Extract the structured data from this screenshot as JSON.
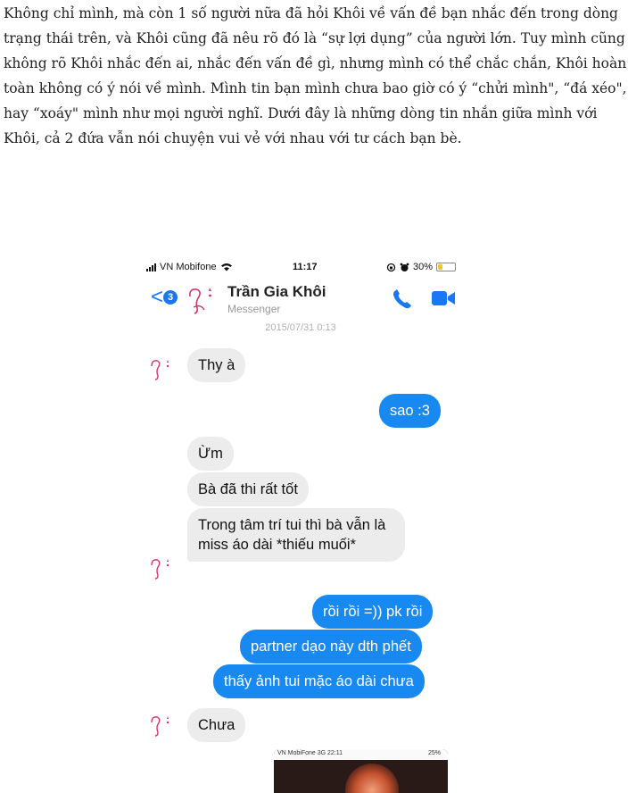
{
  "article": {
    "paragraph": "Không chỉ mình, mà còn 1 số người nữa đã hỏi Khôi về vấn đề bạn nhắc đến trong dòng trạng thái trên, và Khôi cũng đã nêu rõ đó là “sự lợi dụng” của người lớn. Tuy mình cũng không rõ Khôi nhắc đến ai, nhắc đến vấn đề gì, nhưng mình có thể chắc chắn, Khôi hoàn toàn không có ý nói về mình. Mình tin bạn mình chưa bao giờ có ý “chửi mình\", “đá xéo\", hay “xoáy\" mình như mọi người nghĩ. Dưới đây là những dòng tin nhắn giữa mình với Khôi, cả 2 đứa vẫn nói chuyện vui vẻ với nhau với tư cách bạn bè."
  },
  "status_bar": {
    "carrier": "VN Mobifone",
    "time": "11:17",
    "battery": "30%",
    "battery_level": 0.3
  },
  "header": {
    "back_count": "3",
    "contact_name": "Trần Gia Khôi",
    "subtitle": "Messenger"
  },
  "date_stamp": "2015/07/31 0:13",
  "messages": [
    {
      "from": "them",
      "text": "Thy à"
    },
    {
      "from": "me",
      "text": "sao :3"
    },
    {
      "from": "them",
      "text": "Ừm"
    },
    {
      "from": "them",
      "text": "Bà đã thi rất tốt"
    },
    {
      "from": "them",
      "text": "Trong tâm trí tui thì bà vẫn là miss áo dài *thiếu muối*"
    },
    {
      "from": "me",
      "text": "rồi rồi =)) pk rồi"
    },
    {
      "from": "me",
      "text": "partner dạo này dth phết"
    },
    {
      "from": "me",
      "text": "thấy ảnh tui mặc áo dài chưa"
    },
    {
      "from": "them",
      "text": "Chưa"
    }
  ],
  "attached_image": {
    "status_left": "VN MobiFone 3G 22:11",
    "status_right": "25%"
  },
  "colors": {
    "messenger_blue": "#1889f0",
    "incoming_bubble": "#ececec"
  }
}
